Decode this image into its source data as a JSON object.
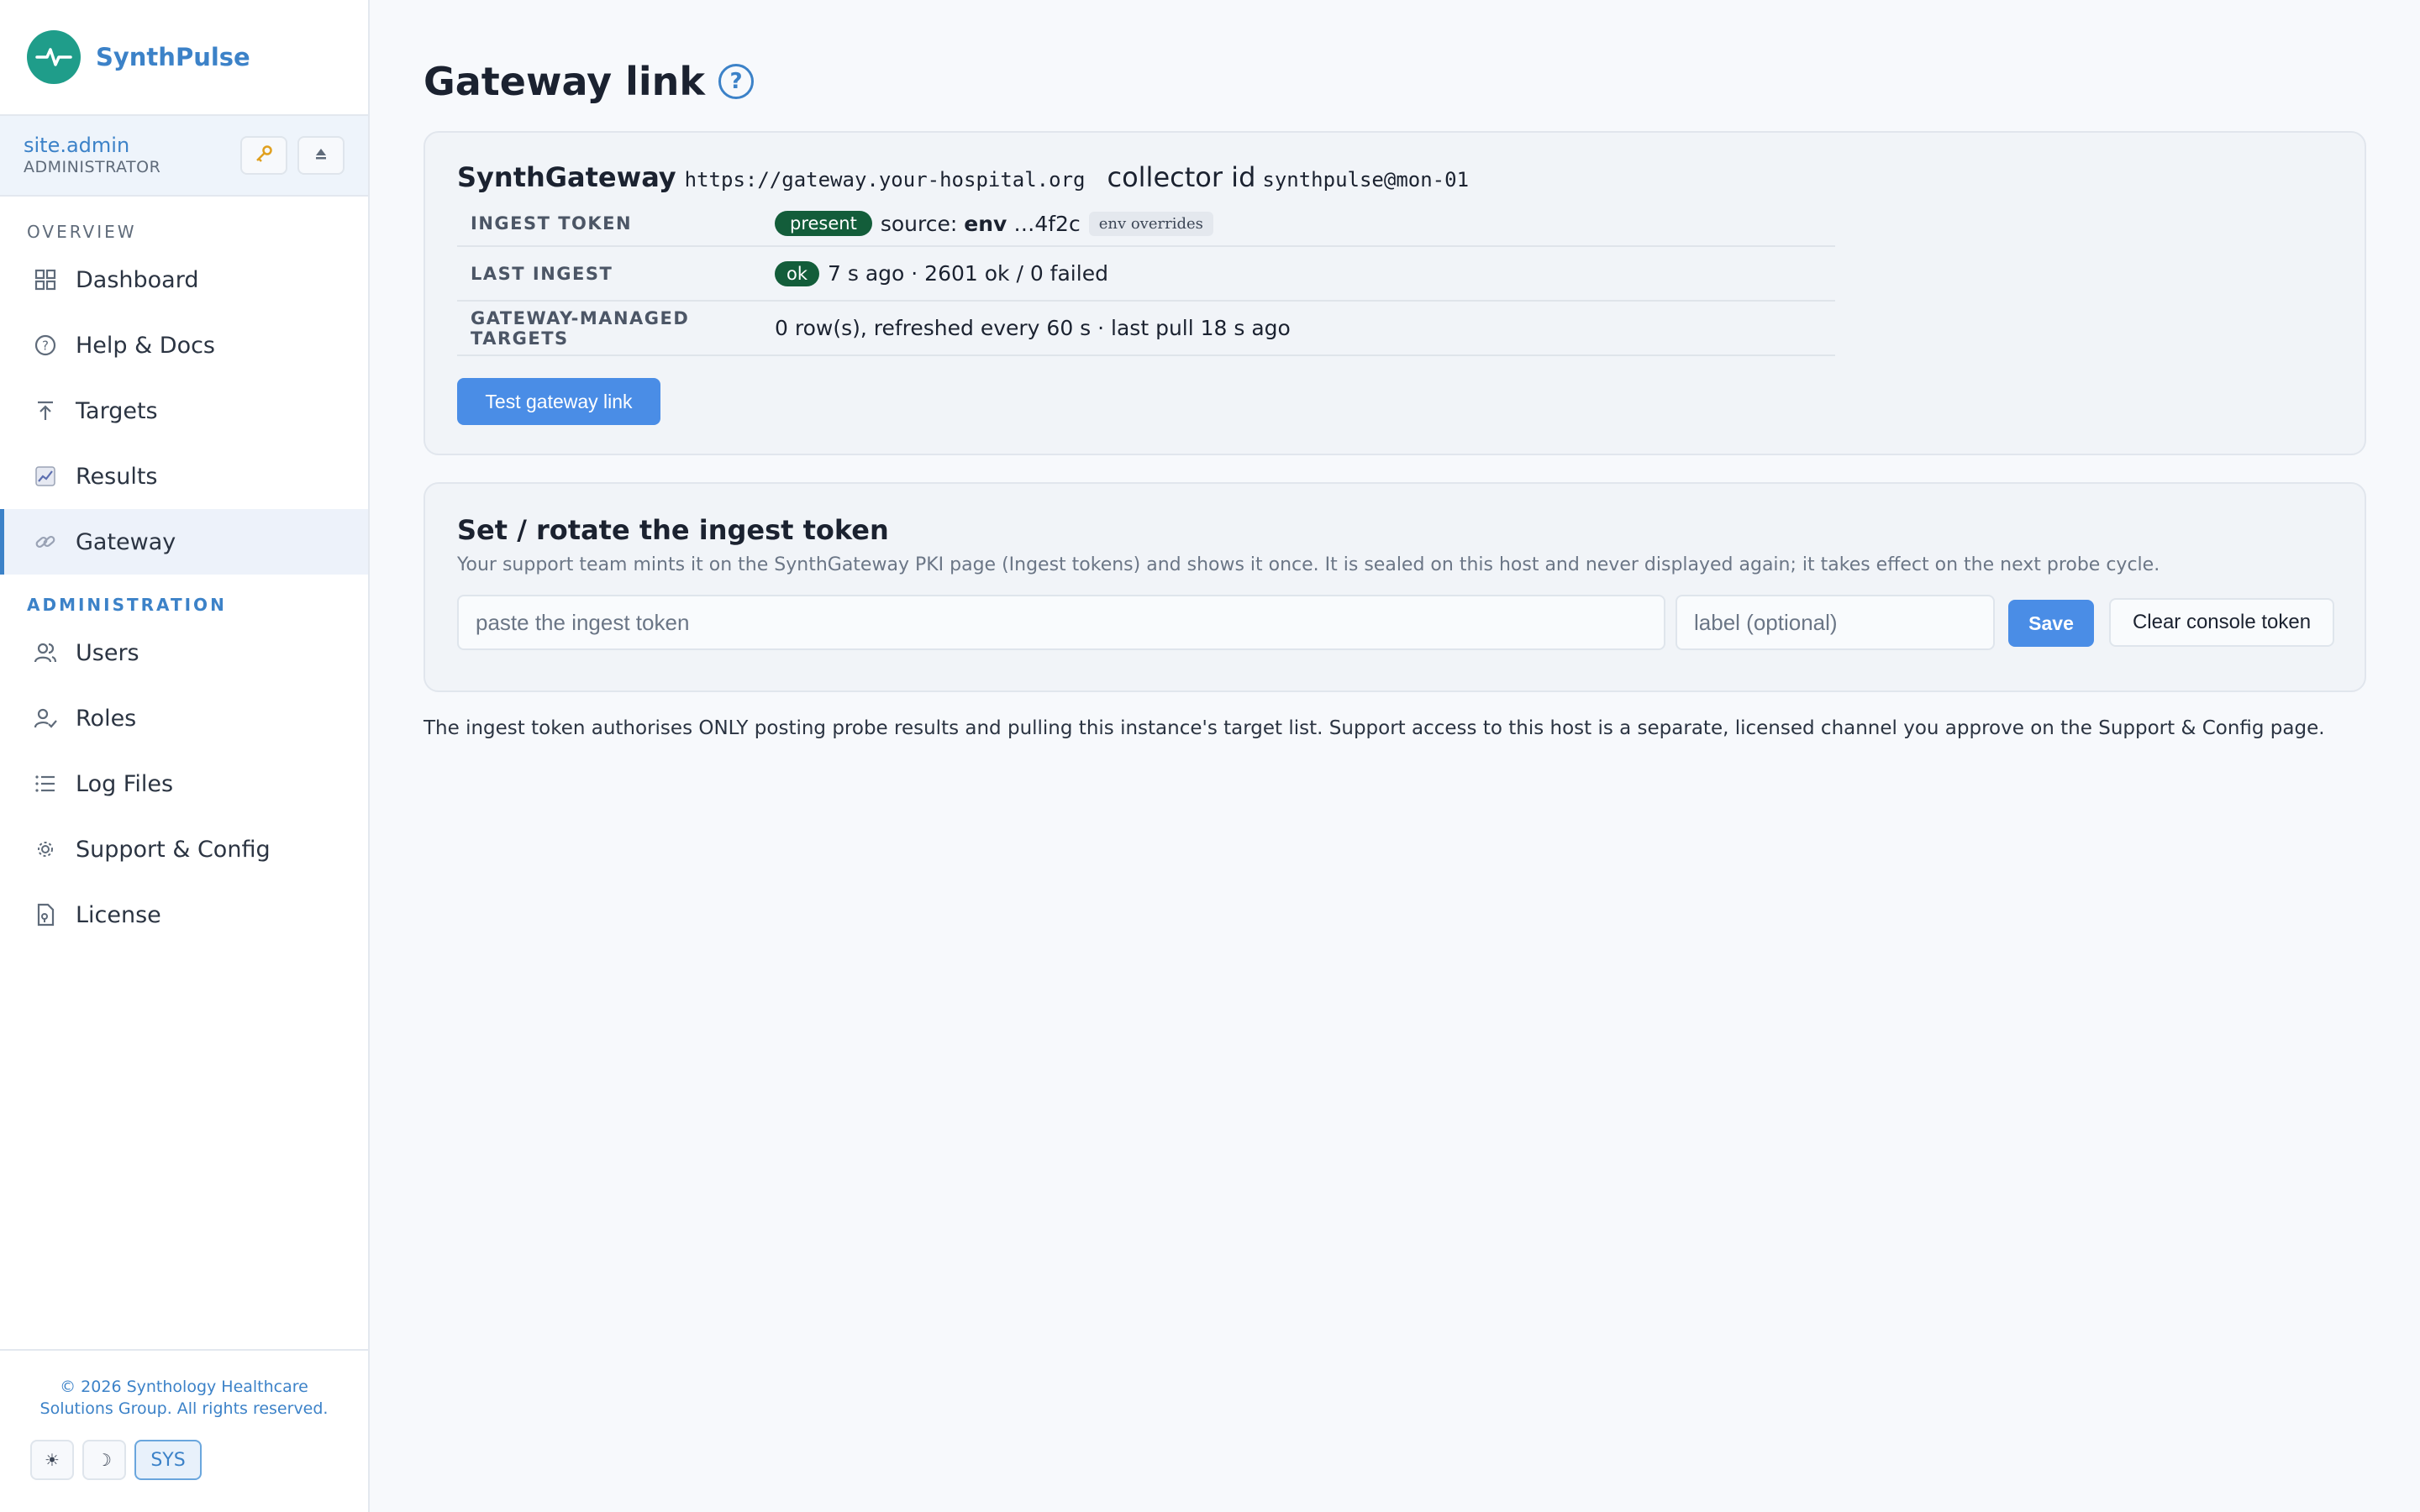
{
  "sidebar": {
    "brand_name": "SynthPulse",
    "user": {
      "name": "site.admin",
      "role": "ADMINISTRATOR"
    },
    "sections": {
      "overview": "OVERVIEW",
      "administration": "ADMINISTRATION"
    },
    "items": [
      {
        "label": "Dashboard",
        "icon": "grid-icon"
      },
      {
        "label": "Help & Docs",
        "icon": "question-circle-icon"
      },
      {
        "label": "Targets",
        "icon": "arrow-up-icon"
      },
      {
        "label": "Results",
        "icon": "chart-icon"
      },
      {
        "label": "Gateway",
        "icon": "link-icon",
        "active": true
      },
      {
        "label": "Users",
        "icon": "users-icon"
      },
      {
        "label": "Roles",
        "icon": "user-check-icon"
      },
      {
        "label": "Log Files",
        "icon": "list-icon"
      },
      {
        "label": "Support & Config",
        "icon": "gear-icon"
      },
      {
        "label": "License",
        "icon": "document-icon"
      }
    ],
    "footer": {
      "copyright": "© 2026 Synthology Healthcare Solutions Group. All rights reserved.",
      "theme_light": "☀",
      "theme_dark": "☽",
      "theme_sys": "SYS"
    }
  },
  "page": {
    "title": "Gateway link",
    "help": "?"
  },
  "gateway": {
    "name": "SynthGateway",
    "url": "https://gateway.your-hospital.org",
    "collector_label": "collector id",
    "collector_id": "synthpulse@mon-01",
    "rows": {
      "ingest_token": {
        "key": "INGEST TOKEN",
        "status": "present",
        "source_label": "source:",
        "source": "env",
        "suffix": "…4f2c",
        "chip": "env overrides"
      },
      "last_ingest": {
        "key": "LAST INGEST",
        "status": "ok",
        "text": "7 s ago · 2601 ok / 0 failed"
      },
      "targets": {
        "key": "GATEWAY-MANAGED TARGETS",
        "text": "0 row(s), refreshed every 60 s · last pull 18 s ago"
      }
    },
    "test_button": "Test gateway link"
  },
  "rotate": {
    "title": "Set / rotate the ingest token",
    "description": "Your support team mints it on the SynthGateway PKI page (Ingest tokens) and shows it once. It is sealed on this host and never displayed again; it takes effect on the next probe cycle.",
    "token_placeholder": "paste the ingest token",
    "label_placeholder": "label (optional)",
    "save": "Save",
    "clear": "Clear console token"
  },
  "note": "The ingest token authorises ONLY posting probe results and pulling this instance's target list. Support access to this host is a separate, licensed channel you approve on the Support & Config page.",
  "colors": {
    "accent": "#3c82c8",
    "brand": "#1f9d8a",
    "status_ok": "#135d3a",
    "button": "#4a8de6"
  }
}
